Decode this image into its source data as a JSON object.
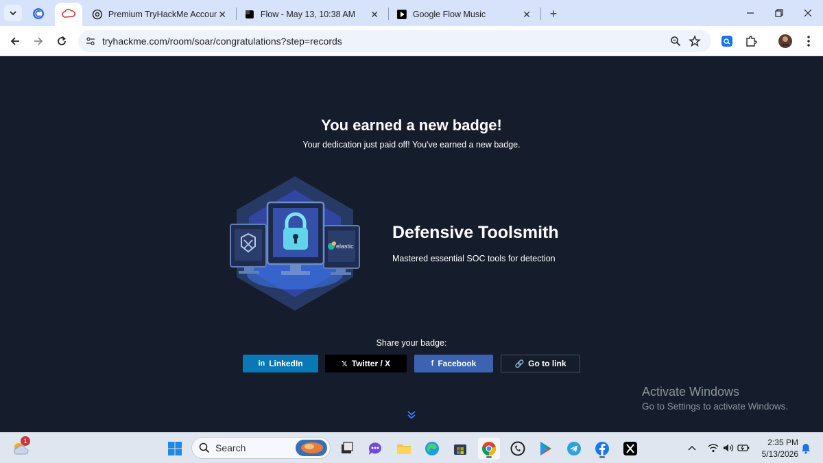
{
  "browser": {
    "tabs": [
      {
        "title": "Premium TryHackMe Account U",
        "active": false
      },
      {
        "title": "Flow - May 13, 10:38 AM",
        "active": false
      },
      {
        "title": "Google Flow Music",
        "active": false
      }
    ],
    "url": "tryhackme.com/room/soar/congratulations?step=records"
  },
  "page": {
    "headline": "You earned a new badge!",
    "subline": "Your dedication just paid off! You've earned a new badge.",
    "badge": {
      "name": "Defensive Toolsmith",
      "description": "Mastered essential SOC tools for detection",
      "monitor_text": "elastic"
    },
    "share": {
      "label": "Share your badge:",
      "buttons": [
        {
          "label": "LinkedIn",
          "icon_text": "in",
          "color": "#0a78b5"
        },
        {
          "label": "Twitter / X",
          "icon_text": "𝕏",
          "color": "#000000"
        },
        {
          "label": "Facebook",
          "icon_text": "f",
          "color": "#3b63b0"
        },
        {
          "label": "Go to link",
          "icon_text": "🔗",
          "color": "#151c2b"
        }
      ]
    }
  },
  "watermark": {
    "title": "Activate Windows",
    "subtitle": "Go to Settings to activate Windows."
  },
  "taskbar": {
    "weather_badge": "1",
    "search_label": "Search",
    "time": "2:35 PM",
    "date": "5/13/2026"
  },
  "colors": {
    "page_bg": "#151c2b",
    "tabbar_bg": "#d7e3fb",
    "accent_blue": "#3b82f6"
  }
}
